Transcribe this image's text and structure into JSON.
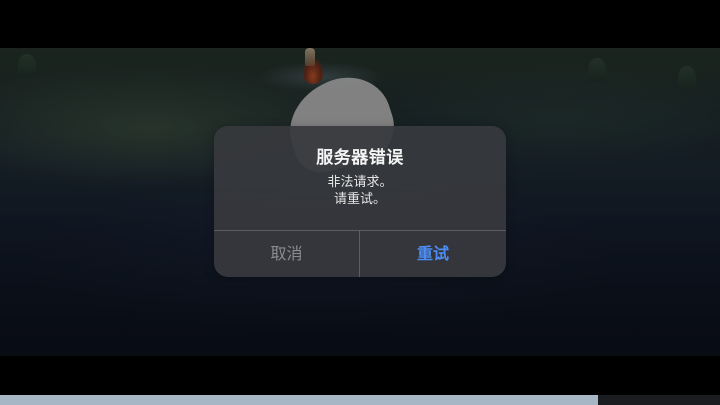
{
  "dialog": {
    "title": "服务器错误",
    "message_lines": [
      "非法请求。",
      "请重试。"
    ],
    "cancel_label": "取消",
    "retry_label": "重试"
  },
  "colors": {
    "cancel_text": "#8a8c90",
    "retry_text": "#4d8df5",
    "dialog_bg": "#37393d"
  }
}
